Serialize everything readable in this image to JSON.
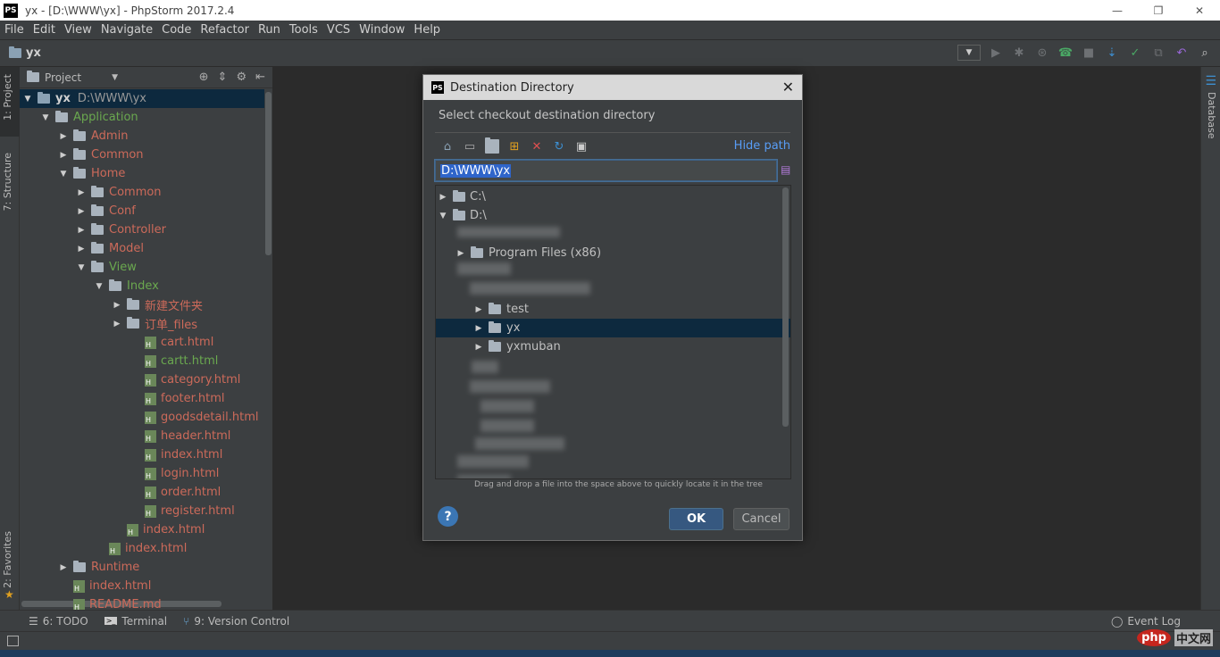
{
  "window": {
    "title": "yx - [D:\\WWW\\yx] - PhpStorm 2017.2.4",
    "logo": "PS",
    "controls": [
      "—",
      "❐",
      "✕"
    ]
  },
  "menu": [
    "File",
    "Edit",
    "View",
    "Navigate",
    "Code",
    "Refactor",
    "Run",
    "Tools",
    "VCS",
    "Window",
    "Help"
  ],
  "navbar": {
    "crumb": "yx"
  },
  "left_tabs": {
    "project": "1: Project",
    "structure": "7: Structure",
    "favorites": "2: Favorites"
  },
  "right_tabs": {
    "database": "Database"
  },
  "project": {
    "header": "Project",
    "root_name": "yx",
    "root_path": "D:\\WWW\\yx",
    "items": [
      {
        "label": "Application",
        "color": "green",
        "type": "folder",
        "expanded": true
      },
      {
        "label": "Admin",
        "color": "red",
        "type": "folder"
      },
      {
        "label": "Common",
        "color": "red",
        "type": "folder"
      },
      {
        "label": "Home",
        "color": "red",
        "type": "folder",
        "expanded": true
      },
      {
        "label": "Common",
        "color": "red",
        "type": "folder"
      },
      {
        "label": "Conf",
        "color": "red",
        "type": "folder"
      },
      {
        "label": "Controller",
        "color": "red",
        "type": "folder"
      },
      {
        "label": "Model",
        "color": "red",
        "type": "folder"
      },
      {
        "label": "View",
        "color": "green",
        "type": "folder",
        "expanded": true
      },
      {
        "label": "Index",
        "color": "green",
        "type": "folder",
        "expanded": true
      },
      {
        "label": "新建文件夹",
        "color": "red",
        "type": "folder"
      },
      {
        "label": "订单_files",
        "color": "red",
        "type": "folder"
      },
      {
        "label": "cart.html",
        "color": "red",
        "type": "file"
      },
      {
        "label": "cartt.html",
        "color": "green",
        "type": "file"
      },
      {
        "label": "category.html",
        "color": "red",
        "type": "file"
      },
      {
        "label": "footer.html",
        "color": "red",
        "type": "file"
      },
      {
        "label": "goodsdetail.html",
        "color": "red",
        "type": "file"
      },
      {
        "label": "header.html",
        "color": "red",
        "type": "file"
      },
      {
        "label": "index.html",
        "color": "red",
        "type": "file"
      },
      {
        "label": "login.html",
        "color": "red",
        "type": "file"
      },
      {
        "label": "order.html",
        "color": "red",
        "type": "file"
      },
      {
        "label": "register.html",
        "color": "red",
        "type": "file"
      },
      {
        "label": "index.html",
        "color": "red",
        "type": "file"
      },
      {
        "label": "index.html",
        "color": "red",
        "type": "file"
      },
      {
        "label": "Runtime",
        "color": "red",
        "type": "folder"
      },
      {
        "label": "index.html",
        "color": "red",
        "type": "file"
      },
      {
        "label": "README.md",
        "color": "red",
        "type": "file"
      }
    ]
  },
  "bottom_tools": {
    "todo": "6: TODO",
    "terminal": "Terminal",
    "vcs": "9: Version Control",
    "event_log": "Event Log"
  },
  "dialog": {
    "title": "Destination Directory",
    "prompt": "Select checkout destination directory",
    "hide_path": "Hide path",
    "path_value": "D:\\WWW\\yx",
    "tree": {
      "c_drive": "C:\\",
      "d_drive": "D:\\",
      "program_files": "Program Files (x86)",
      "test": "test",
      "yx": "yx",
      "yxmuban": "yxmuban"
    },
    "hint": "Drag and drop a file into the space above to quickly locate it in the tree",
    "ok": "OK",
    "cancel": "Cancel",
    "help": "?"
  },
  "watermark": {
    "php": "php",
    "cn": "中文网"
  },
  "colors": {
    "red_file": "#cc6a5a",
    "green_file": "#6aa84f",
    "selection": "#0d293e",
    "link": "#589df6"
  }
}
